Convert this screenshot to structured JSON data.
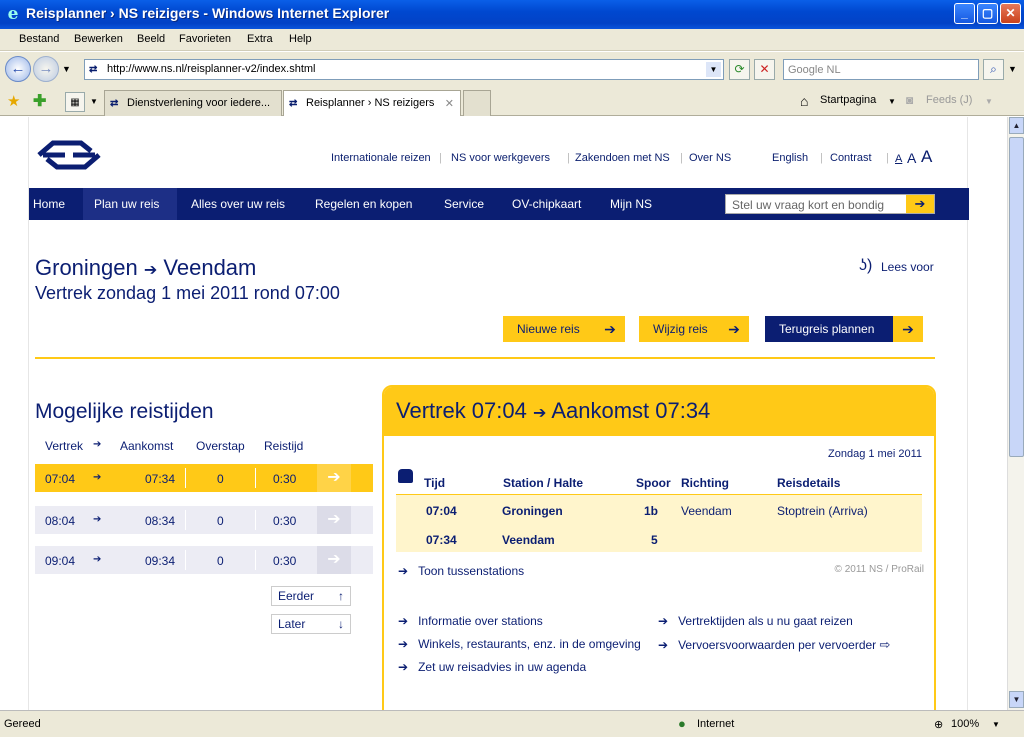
{
  "window": {
    "title": "Reisplanner › NS reizigers - Windows Internet Explorer"
  },
  "menu": [
    "Bestand",
    "Bewerken",
    "Beeld",
    "Favorieten",
    "Extra",
    "Help"
  ],
  "address": {
    "url": "http://www.ns.nl/reisplanner-v2/index.shtml",
    "search_placeholder": "Google NL"
  },
  "tabs": [
    {
      "label": "Dienstverlening voor iedere..."
    },
    {
      "label": "Reisplanner › NS reizigers"
    }
  ],
  "commandbar": {
    "home": "Startpagina",
    "feeds": "Feeds (J)"
  },
  "toplinks": [
    "Internationale reizen",
    "NS voor werkgevers",
    "Zakendoen met NS",
    "Over NS",
    "English",
    "Contrast"
  ],
  "fontsize": [
    "A",
    "A",
    "A"
  ],
  "nav": {
    "items": [
      "Home",
      "Plan uw reis",
      "Alles over uw reis",
      "Regelen en kopen",
      "Service",
      "OV-chipkaart",
      "Mijn NS"
    ],
    "search_placeholder": "Stel uw vraag kort en bondig"
  },
  "journey": {
    "from": "Groningen",
    "to": "Veendam",
    "subtitle": "Vertrek zondag 1 mei 2011 rond 07:00",
    "read_aloud": "Lees voor",
    "btn_new": "Nieuwe reis",
    "btn_change": "Wijzig reis",
    "btn_return": "Terugreis plannen"
  },
  "times": {
    "title": "Mogelijke reistijden",
    "headers": [
      "Vertrek",
      "Aankomst",
      "Overstap",
      "Reistijd"
    ],
    "rows": [
      {
        "dep": "07:04",
        "arr": "07:34",
        "transfers": "0",
        "dur": "0:30"
      },
      {
        "dep": "08:04",
        "arr": "08:34",
        "transfers": "0",
        "dur": "0:30"
      },
      {
        "dep": "09:04",
        "arr": "09:34",
        "transfers": "0",
        "dur": "0:30"
      }
    ],
    "earlier": "Eerder",
    "later": "Later"
  },
  "detail": {
    "dep_label": "Vertrek 07:04",
    "arr_label": "Aankomst 07:34",
    "date": "Zondag 1 mei 2011",
    "headers": [
      "Tijd",
      "Station / Halte",
      "Spoor",
      "Richting",
      "Reisdetails"
    ],
    "rows": [
      {
        "time": "07:04",
        "station": "Groningen",
        "platform": "1b",
        "direction": "Veendam",
        "details": "Stoptrein (Arriva)"
      },
      {
        "time": "07:34",
        "station": "Veendam",
        "platform": "5",
        "direction": "",
        "details": ""
      }
    ],
    "show_stations": "Toon tussenstations",
    "copyright": "© 2011 NS / ProRail",
    "links_left": [
      "Informatie over stations",
      "Winkels, restaurants, enz. in de omgeving",
      "Zet uw reisadvies in uw agenda"
    ],
    "links_right": [
      "Vertrektijden als u nu gaat reizen",
      "Vervoersvoorwaarden per vervoerder"
    ]
  },
  "status": {
    "left": "Gereed",
    "zone": "Internet",
    "zoom": "100%"
  },
  "colors": {
    "ns_blue": "#0b1e72",
    "ns_yellow": "#ffc917"
  }
}
